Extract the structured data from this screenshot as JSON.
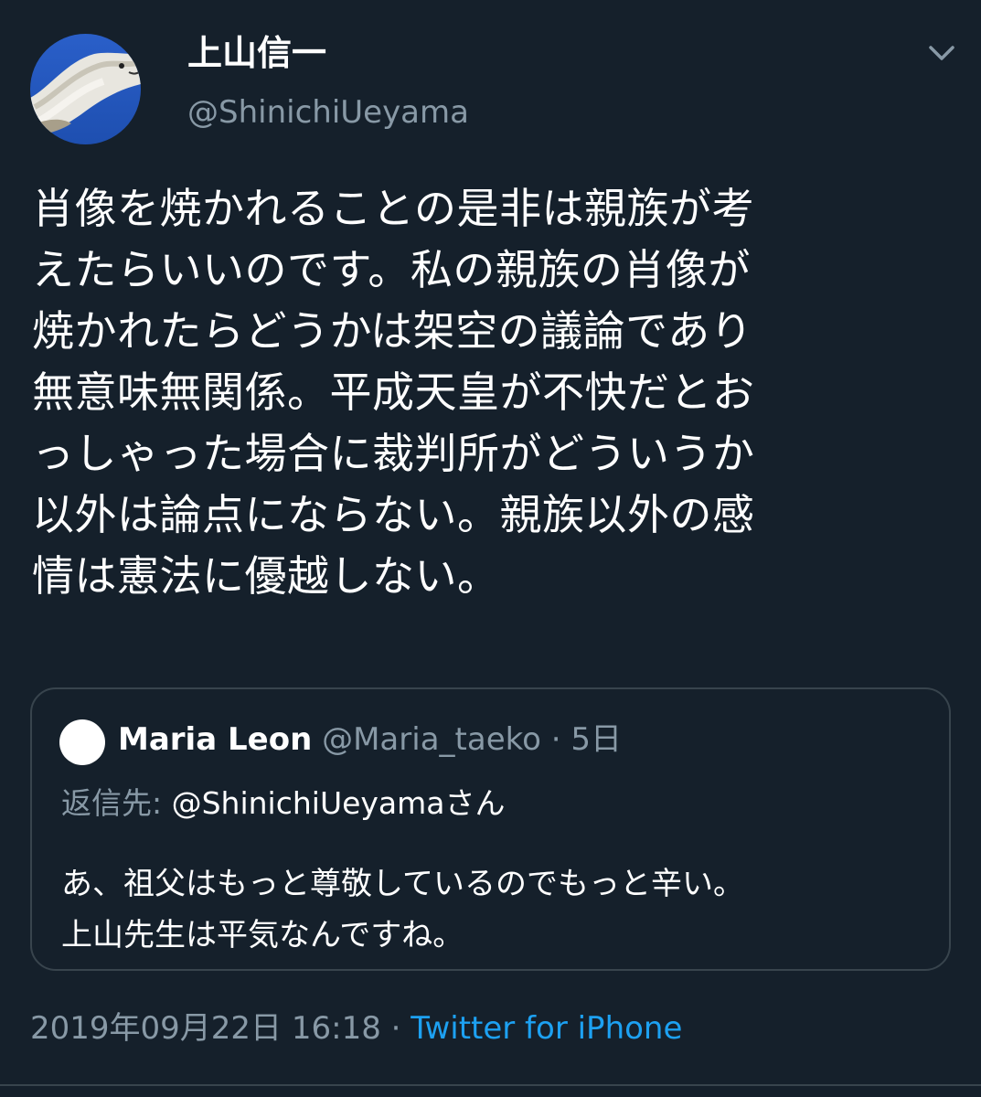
{
  "author": {
    "display_name": "上山信一",
    "handle": "@ShinichiUeyama",
    "avatar_icon": "dog-photo-avatar"
  },
  "menu_icon": "chevron-down-icon",
  "tweet_lines": [
    "肖像を焼かれることの是非は親族が考",
    "えたらいいのです。私の親族の肖像が",
    "焼かれたらどうかは架空の議論であり",
    "無意味無関係。平成天皇が不快だとお",
    "っしゃった場合に裁判所がどういうか",
    "以外は論点にならない。親族以外の感",
    "情は憲法に優越しない。"
  ],
  "quoted_tweet": {
    "name": "Maria Leon",
    "handle": "@Maria_taeko",
    "separator": "·",
    "time": "5日",
    "reply_prefix": "返信先: ",
    "reply_to": "@ShinichiUeyamaさん",
    "text_lines": [
      "あ、祖父はもっと尊敬しているのでもっと辛い。",
      "上山先生は平気なんですね。"
    ]
  },
  "meta": {
    "timestamp": "2019年09月22日 16:18",
    "separator": "·",
    "source": "Twitter for iPhone"
  },
  "colors": {
    "background": "#15202b",
    "secondary_text": "#8899a6",
    "link": "#1da1f2",
    "border": "#38444d"
  }
}
